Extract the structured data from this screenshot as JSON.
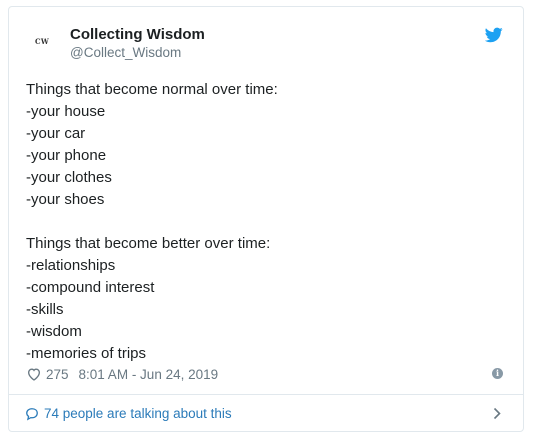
{
  "author": {
    "avatar_text": "CW",
    "name": "Collecting Wisdom",
    "handle": "@Collect_Wisdom"
  },
  "tweet": {
    "section1": {
      "heading": "Things that become normal over time:",
      "items": [
        "-your house",
        "-your car",
        "-your phone",
        "-your clothes",
        "-your shoes"
      ]
    },
    "section2": {
      "heading": "Things that become better over time:",
      "items": [
        "-relationships",
        "-compound interest",
        "-skills",
        "-wisdom",
        "-memories of trips"
      ]
    }
  },
  "meta": {
    "likes": "275",
    "timestamp": "8:01 AM - Jun 24, 2019",
    "info_glyph": "i"
  },
  "footer": {
    "talking": "74 people are talking about this"
  },
  "icons": {
    "brand": "twitter-bird-icon",
    "like": "heart-icon",
    "info": "info-icon",
    "reply": "speech-bubble-icon",
    "more": "chevron-right-icon"
  },
  "colors": {
    "twitter_blue": "#1da1f2",
    "link_blue": "#2b7bb9",
    "muted_gray": "#697882",
    "border": "#e1e8ed",
    "text": "#1c2022"
  }
}
